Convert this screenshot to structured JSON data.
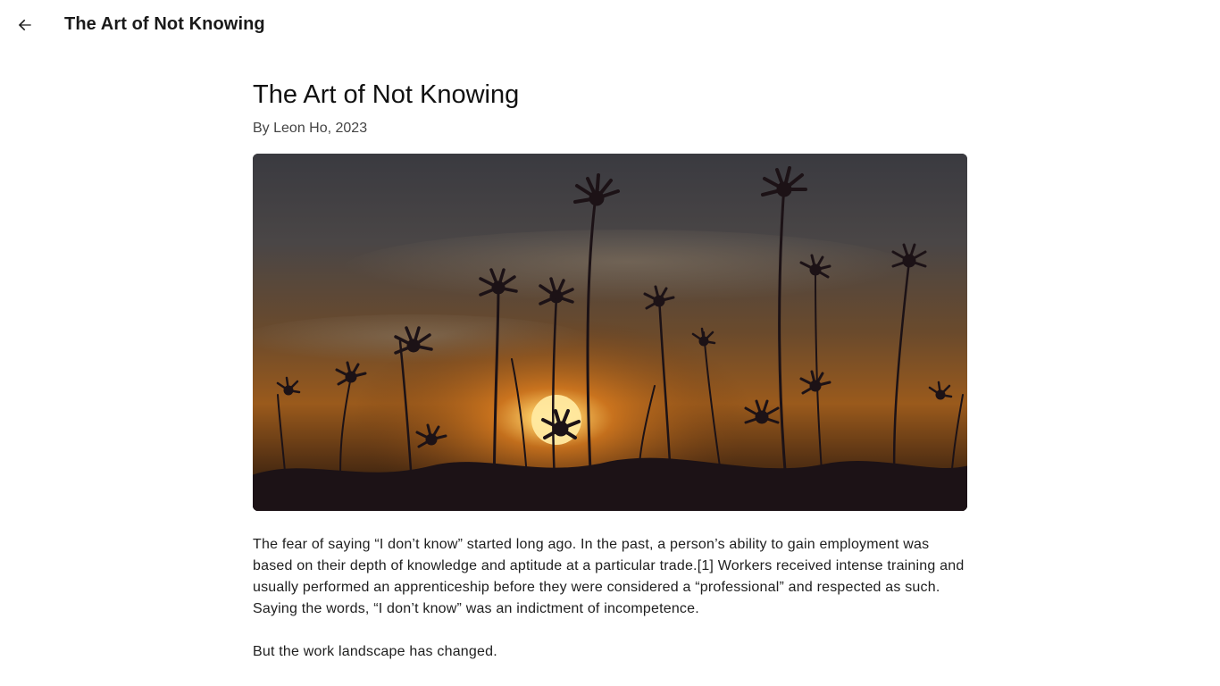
{
  "header": {
    "back_icon": "arrow-left-icon",
    "title": "The Art of Not Knowing"
  },
  "article": {
    "title": "The Art of Not Knowing",
    "byline": "By Leon Ho, 2023",
    "paragraphs": [
      "The fear of saying “I don’t know” started long ago. In the past, a person’s ability to gain employment was based on their depth of knowledge and aptitude at a particular trade.[1] Workers received intense training and usually performed an apprenticeship before they were considered a “professional” and respected as such. Saying the words, “I don’t know” was an indictment of incompetence.",
      "But the work landscape has changed."
    ]
  }
}
